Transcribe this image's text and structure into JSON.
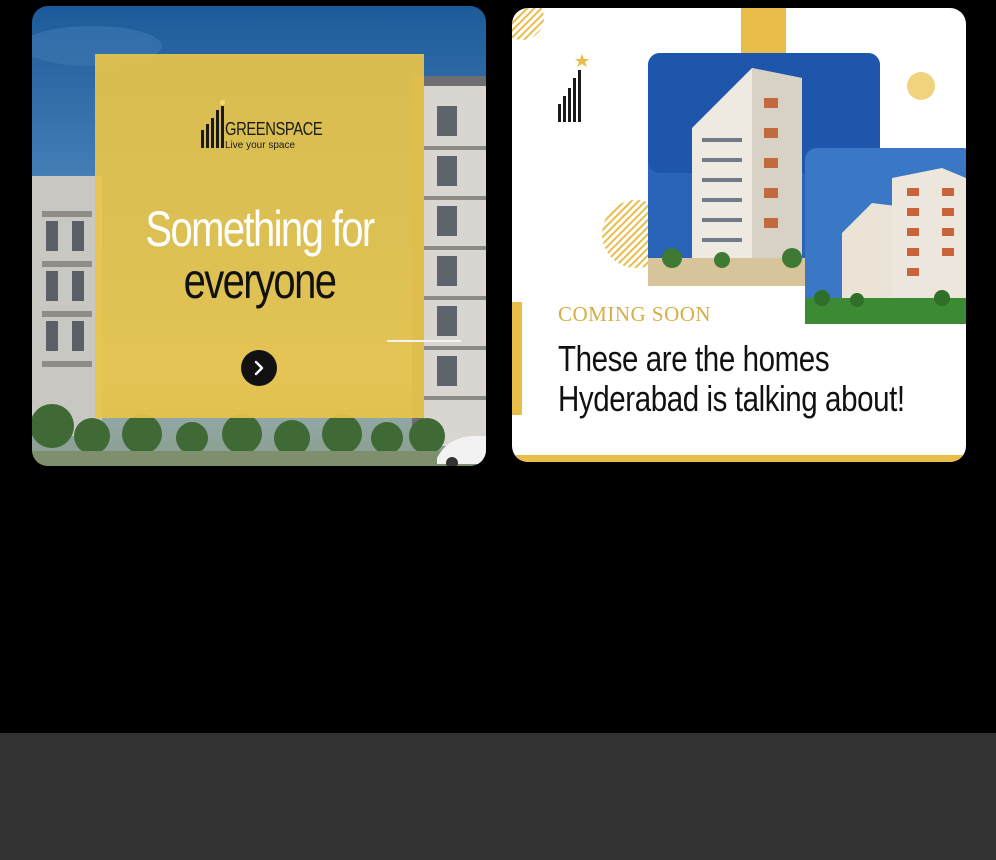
{
  "slides": [
    {
      "brand_name": "GREENSPACE",
      "brand_tagline": "Live your space",
      "headline_line1": "Something for",
      "headline_line2": "everyone",
      "next_icon": "chevron-right-icon",
      "accent_color": "#e8c44a"
    },
    {
      "label": "COMING SOON",
      "headline_line1": "These are the homes",
      "headline_line2": "Hyderabad is talking about!",
      "accent_color": "#d8ad45"
    }
  ]
}
